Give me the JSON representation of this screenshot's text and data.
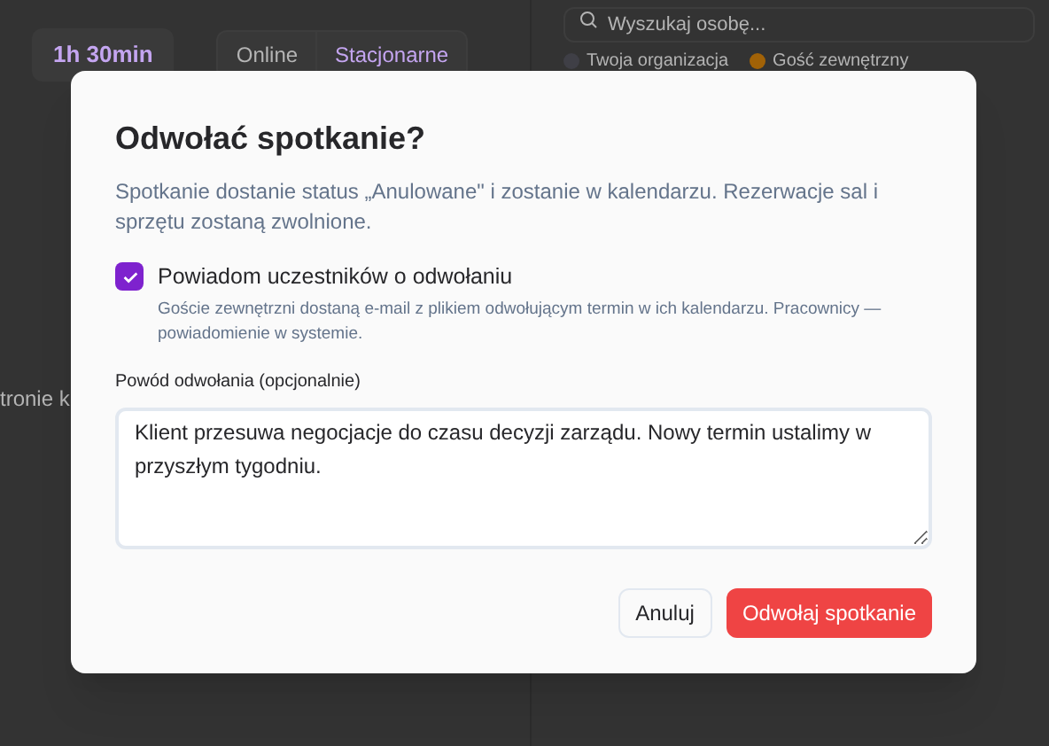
{
  "background": {
    "duration": "1h 30min",
    "mode_tabs": [
      {
        "label": "Online",
        "selected": false
      },
      {
        "label": "Stacjonarne",
        "selected": true
      }
    ],
    "search": {
      "placeholder": "Wyszukaj osobę..."
    },
    "legend": [
      {
        "label": "Twoja organizacja",
        "color": "#3f3f46"
      },
      {
        "label": "Gość zewnętrzny",
        "color": "#a16207"
      }
    ],
    "fragment": "tronie k"
  },
  "dialog": {
    "title": "Odwołać spotkanie?",
    "description": "Spotkanie dostanie status „Anulowane\" i zostanie w kalendarzu. Rezerwacje sal i sprzętu zostaną zwolnione.",
    "notify": {
      "label": "Powiadom uczestników o odwołaniu",
      "checked": true,
      "hint": "Goście zewnętrzni dostaną e-mail z plikiem odwołującym termin w ich kalendarzu. Pracownicy — powiadomienie w systemie."
    },
    "reason": {
      "label": "Powód odwołania (opcjonalnie)",
      "value": "Klient przesuwa negocjacje do czasu decyzji zarządu. Nowy termin ustalimy w przyszłym tygodniu."
    },
    "buttons": [
      {
        "label": "Anuluj",
        "kind": "secondary"
      },
      {
        "label": "Odwołaj spotkanie",
        "kind": "danger"
      }
    ]
  }
}
